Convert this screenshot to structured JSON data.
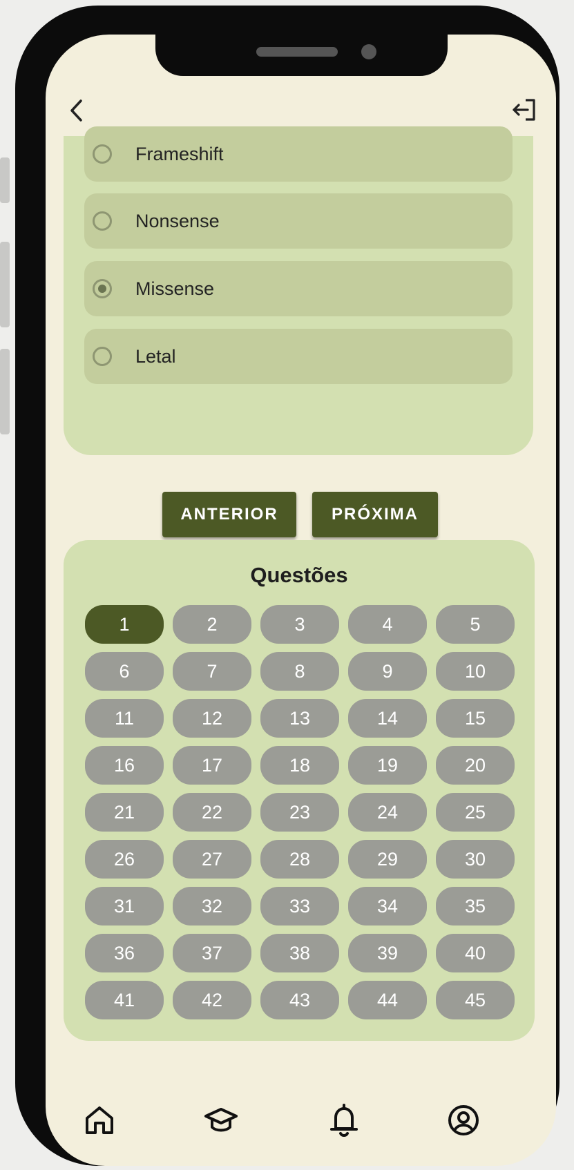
{
  "options": [
    {
      "label": "Frameshift",
      "selected": false
    },
    {
      "label": "Nonsense",
      "selected": false
    },
    {
      "label": "Missense",
      "selected": true
    },
    {
      "label": "Letal",
      "selected": false
    }
  ],
  "buttons": {
    "previous": "ANTERIOR",
    "next": "PRÓXIMA"
  },
  "questions": {
    "title": "Questões",
    "current": 1,
    "numbers": [
      "1",
      "2",
      "3",
      "4",
      "5",
      "6",
      "7",
      "8",
      "9",
      "10",
      "11",
      "12",
      "13",
      "14",
      "15",
      "16",
      "17",
      "18",
      "19",
      "20",
      "21",
      "22",
      "23",
      "24",
      "25",
      "26",
      "27",
      "28",
      "29",
      "30",
      "31",
      "32",
      "33",
      "34",
      "35",
      "36",
      "37",
      "38",
      "39",
      "40",
      "41",
      "42",
      "43",
      "44",
      "45"
    ]
  },
  "icons": {
    "back": "chevron-left-icon",
    "logout": "logout-icon",
    "nav": [
      "home-icon",
      "graduation-cap-icon",
      "bell-icon",
      "user-circle-icon"
    ]
  },
  "colors": {
    "accent": "#4c5925",
    "card": "#d3e0b1",
    "option_bg": "#c3cd9d",
    "question_default": "#9b9c96",
    "screen_bg": "#f3efdc"
  }
}
